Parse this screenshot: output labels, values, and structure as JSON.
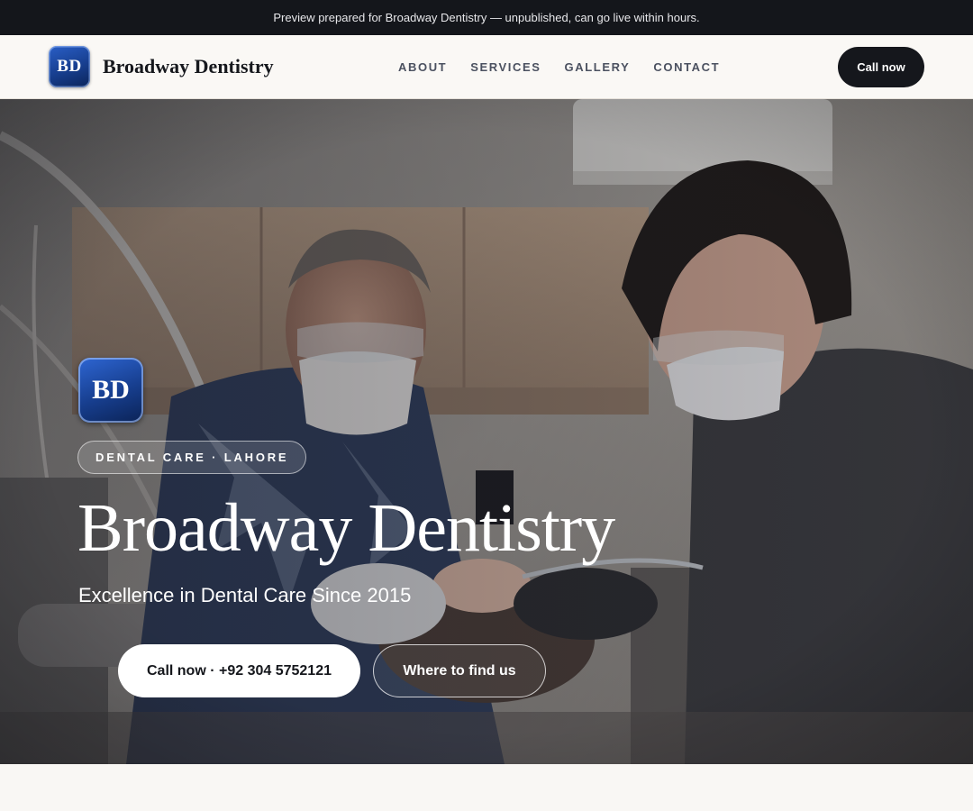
{
  "preview_bar": {
    "text": "Preview prepared for Broadway Dentistry — unpublished, can go live within hours."
  },
  "header": {
    "logo_initials": "BD",
    "brand_name": "Broadway Dentistry",
    "nav": [
      {
        "label": "ABOUT"
      },
      {
        "label": "SERVICES"
      },
      {
        "label": "GALLERY"
      },
      {
        "label": "CONTACT"
      }
    ],
    "call_label": "Call now"
  },
  "hero": {
    "logo_initials": "BD",
    "tag": "DENTAL CARE · LAHORE",
    "title": "Broadway Dentistry",
    "subtitle": "Excellence in Dental Care Since 2015",
    "primary_button": "Call now · +92 304 5752121",
    "secondary_button": "Where to find us",
    "photo_icon": "dentist-treatment-photo"
  },
  "colors": {
    "dark": "#14161b",
    "logo_blue": "#173e8e",
    "background": "#f9f7f4"
  }
}
